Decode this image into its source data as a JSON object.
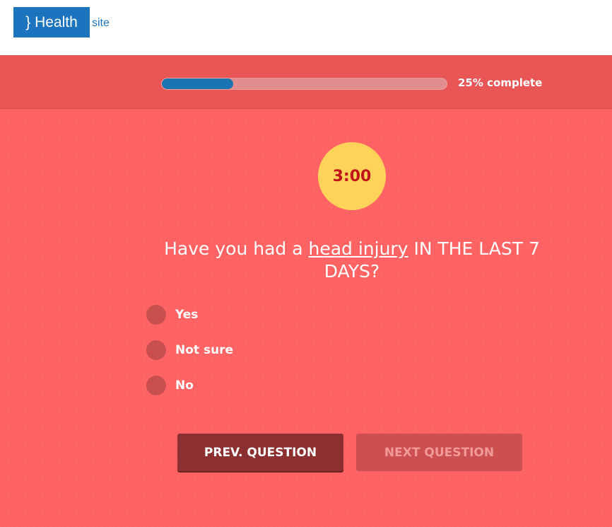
{
  "header": {
    "logo_text": "} Health",
    "logo_suffix": "site",
    "brand_color": "#1b74bd"
  },
  "progress": {
    "fraction": 0.25,
    "label": "25% complete",
    "fill_color": "#1a74b1"
  },
  "timer": {
    "value": "3:00"
  },
  "question": {
    "prefix": "Have you had a ",
    "link_text": "head injury",
    "suffix": " IN THE LAST 7 DAYS?"
  },
  "options": [
    {
      "label": "Yes",
      "selected": false
    },
    {
      "label": "Not sure",
      "selected": false
    },
    {
      "label": "No",
      "selected": false
    }
  ],
  "buttons": {
    "prev_label": "PREV. QUESTION",
    "next_label": "NEXT QUESTION",
    "next_disabled": true
  },
  "colors": {
    "quiz_background": "#ff6363",
    "band_background": "#e85656",
    "timer_background": "#ffd35a",
    "timer_text": "#c0141a"
  }
}
